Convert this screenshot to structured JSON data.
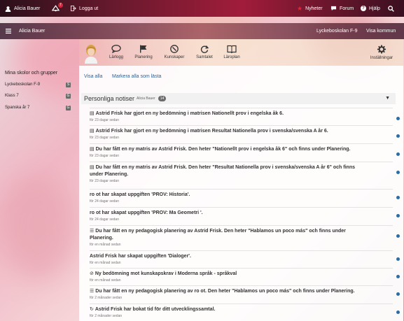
{
  "topbar": {
    "user_name": "Alicia Bauer",
    "notif_count": "7",
    "logout": "Logga ut",
    "news": "Nyheter",
    "forum": "Forum",
    "help": "Hjälp"
  },
  "bar2": {
    "user_name": "Alicia Bauer",
    "school": "Lyckeboskolan F-9",
    "municipality": "Visa kommun"
  },
  "tools": [
    {
      "label": "Lärlogg",
      "icon": "chat-icon"
    },
    {
      "label": "Planering",
      "icon": "flag-icon"
    },
    {
      "label": "Kunskaper",
      "icon": "compass-icon"
    },
    {
      "label": "Samtalet",
      "icon": "refresh-icon"
    },
    {
      "label": "Läroplan",
      "icon": "book-icon"
    }
  ],
  "settings": "Inställningar",
  "sidebar": {
    "title": "Mina skolor och grupper",
    "items": [
      {
        "label": "Lyckeboskolan F-9"
      },
      {
        "label": "Klass 7"
      },
      {
        "label": "Spanska år 7"
      }
    ]
  },
  "links": {
    "show_all": "Visa alla",
    "mark_read": "Markera alla som lästa"
  },
  "panel": {
    "title": "Personliga notiser",
    "subtitle": "Alicia Bauer",
    "count": "14"
  },
  "notices": [
    {
      "icon": "matrix-icon",
      "text": "Astrid Frisk har gjort en ny bedömning i matrisen Nationellt prov i engelska åk 6.",
      "time": "för 23 dagar sedan"
    },
    {
      "icon": "matrix-icon",
      "text": "Astrid Frisk har gjort en ny bedömning i matrisen Resultat Nationella prov i svenska/svenska A år 6.",
      "time": "för 23 dagar sedan"
    },
    {
      "icon": "matrix-icon",
      "text": "Du har fått en ny matris av Astrid Frisk. Den heter \"Nationellt prov i engelska åk 6\" och finns under Planering.",
      "time": "för 23 dagar sedan"
    },
    {
      "icon": "matrix-icon",
      "text": "Du har fått en ny matris av Astrid Frisk. Den heter \"Resultat Nationella prov i svenska/svenska A år 6\" och finns under Planering.",
      "time": "för 23 dagar sedan"
    },
    {
      "icon": "",
      "text": "ro ot har skapat uppgiften 'PROV: Historia'.",
      "time": "för 24 dagar sedan"
    },
    {
      "icon": "",
      "text": "ro ot har skapat uppgiften 'PROV: Ma Geometri '.",
      "time": "för 24 dagar sedan"
    },
    {
      "icon": "list-icon",
      "text": "Du har fått en ny pedagogisk planering av Astrid Frisk. Den heter \"Hablamos un poco más\" och finns under Planering.",
      "time": "för en månad sedan"
    },
    {
      "icon": "",
      "text": "Astrid Frisk har skapat uppgiften 'Dialoger'.",
      "time": "för en månad sedan"
    },
    {
      "icon": "compass-icon",
      "text": "Ny bedömning mot kunskapskrav i Moderna språk - språkval",
      "time": "för en månad sedan"
    },
    {
      "icon": "list-icon",
      "text": "Du har fått en ny pedagogisk planering av ro ot. Den heter \"Hablamos un poco más\" och finns under Planering.",
      "time": "för 2 månader sedan"
    },
    {
      "icon": "refresh-icon",
      "text": "Astrid Frisk har bokat tid för ditt utvecklingssamtal.",
      "time": "för 2 månader sedan"
    }
  ]
}
